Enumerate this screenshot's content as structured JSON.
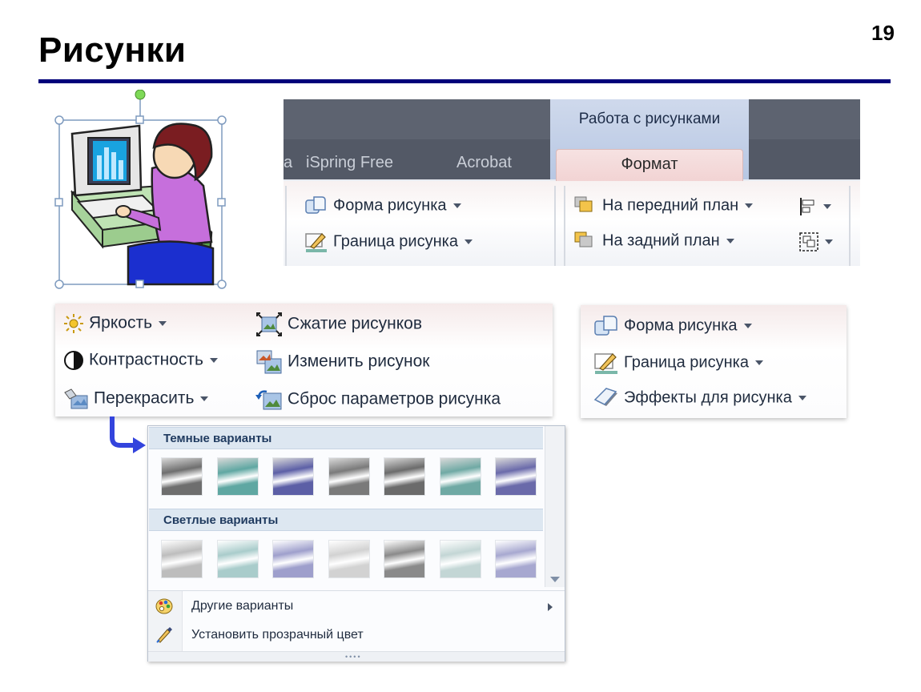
{
  "slide": {
    "title": "Рисунки",
    "page_number": "19"
  },
  "ribbon": {
    "context_group": "Работа с рисунками",
    "tabs": [
      "a",
      "iSpring Free",
      "Acrobat"
    ],
    "active_tab": "Формат",
    "shape_label": "Форма рисунка",
    "border_label": "Граница рисунка",
    "bring_front_label": "На передний план",
    "send_back_label": "На задний план"
  },
  "adjust": {
    "brightness": "Яркость",
    "contrast": "Контрастность",
    "recolor": "Перекрасить",
    "compress": "Сжатие рисунков",
    "change": "Изменить рисунок",
    "reset": "Сброс параметров рисунка"
  },
  "styles": {
    "shape": "Форма рисунка",
    "border": "Граница рисунка",
    "effects": "Эффекты для рисунка"
  },
  "recolor_menu": {
    "dark_header": "Темные варианты",
    "light_header": "Светлые варианты",
    "more": "Другие варианты",
    "transparent": "Установить прозрачный цвет",
    "dark_swatches": [
      "#6e6e6e",
      "#5fa7a2",
      "#5c5fa6",
      "#7a7a7a",
      "#6b6b6b",
      "#6fa9a4",
      "#6a6aaa"
    ],
    "light_swatches": [
      "#bdbdbd",
      "#a9cccb",
      "#9e9fcc",
      "#d2d2d2",
      "#8a8a8a",
      "#c3d6d5",
      "#a7a8d0"
    ]
  },
  "colors": {
    "accent": "#00007a",
    "pointer_arrow": "#3344dd"
  }
}
